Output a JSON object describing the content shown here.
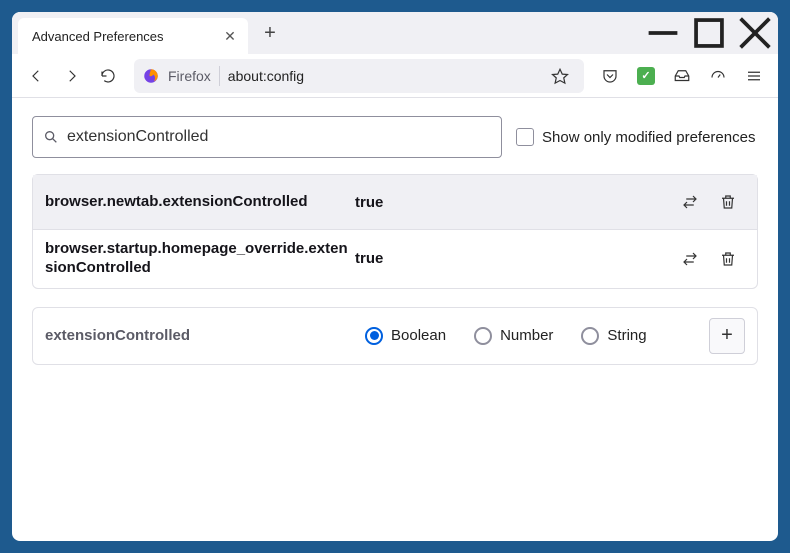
{
  "window": {
    "tab_title": "Advanced Preferences",
    "url_prefix": "Firefox",
    "url": "about:config"
  },
  "search": {
    "value": "extensionControlled",
    "checkbox_label": "Show only modified preferences",
    "checkbox_checked": false
  },
  "prefs": [
    {
      "name": "browser.newtab.extensionControlled",
      "value": "true"
    },
    {
      "name": "browser.startup.homepage_override.extensionControlled",
      "value": "true"
    }
  ],
  "new_pref": {
    "name": "extensionControlled",
    "types": {
      "boolean": "Boolean",
      "number": "Number",
      "string": "String"
    },
    "selected": "boolean"
  }
}
